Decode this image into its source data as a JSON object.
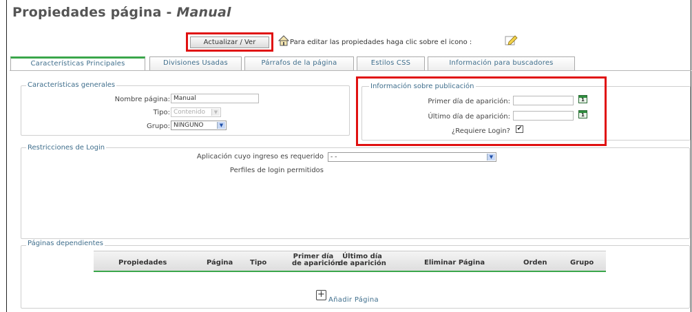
{
  "header": {
    "title_prefix": "Propiedades página - ",
    "title_name": "Manual",
    "update_button": "Actualizar / Ver",
    "help_text": "Para editar las propiedades haga clic sobre el icono :"
  },
  "tabs": [
    {
      "label": "Características Principales",
      "active": true
    },
    {
      "label": "Divisiones Usadas",
      "active": false
    },
    {
      "label": "Párrafos de la página",
      "active": false
    },
    {
      "label": "Estilos CSS",
      "active": false
    },
    {
      "label": "Información para buscadores",
      "active": false
    }
  ],
  "general": {
    "legend": "Características generales",
    "name_label": "Nombre página:",
    "name_value": "Manual",
    "type_label": "Tipo:",
    "type_value": "Contenido",
    "group_label": "Grupo:",
    "group_value": "NINGUNO"
  },
  "publication": {
    "legend": "Información sobre publicación",
    "first_day_label": "Primer día de aparición:",
    "first_day_value": "",
    "last_day_label": "Último día de aparición:",
    "last_day_value": "",
    "login_label": "¿Requiere Login?",
    "login_checked": true,
    "check_mark": "✔"
  },
  "login": {
    "legend": "Restricciones de Login",
    "app_label": "Aplicación cuyo ingreso es requerido",
    "app_value": "- -",
    "profiles_label": "Perfiles de login permitidos"
  },
  "dependents": {
    "legend": "Páginas dependientes",
    "columns": {
      "propiedades": "Propiedades",
      "pagina": "Página",
      "tipo": "Tipo",
      "primer_1": "Primer día",
      "primer_2": "de aparición",
      "ultimo_1": "Último día",
      "ultimo_2": "de aparición",
      "eliminar": "Eliminar Página",
      "orden": "Orden",
      "grupo": "Grupo"
    },
    "add_plus": "+",
    "add_label": "Añadir Página"
  },
  "colors": {
    "accent_green": "#3aa64a",
    "highlight_red": "#e01010",
    "link_blue": "#3f6e8c"
  },
  "icons": {
    "help": "home-help-icon",
    "edit": "pencil-icon",
    "calendar": "calendar-icon",
    "dropdown": "chevron-down-icon"
  }
}
